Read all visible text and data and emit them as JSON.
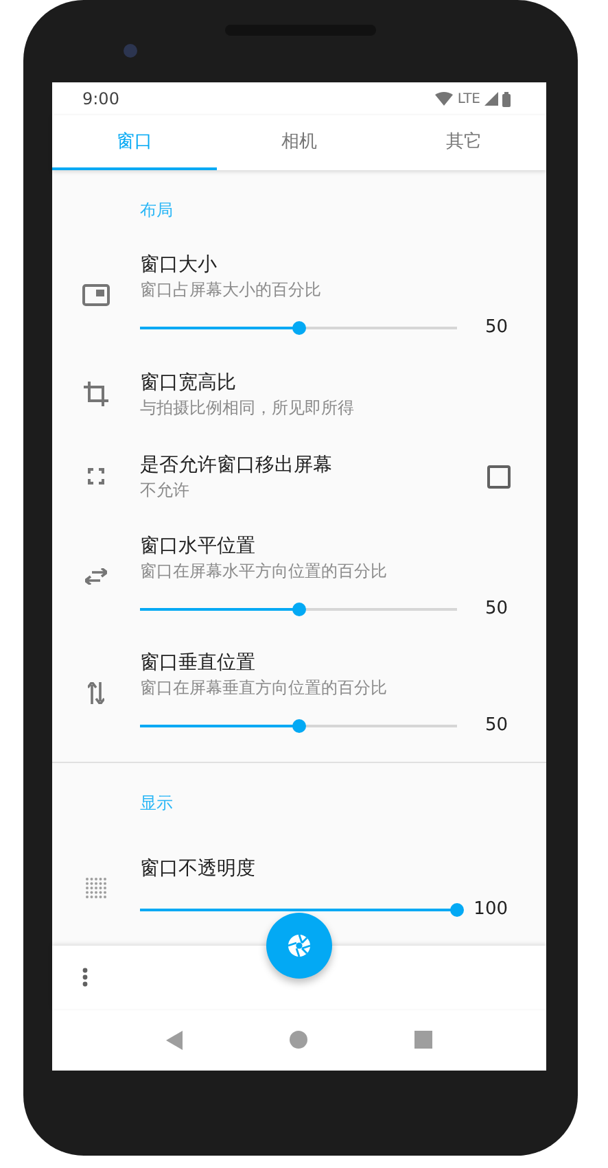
{
  "status_bar": {
    "time": "9:00",
    "network": "LTE"
  },
  "tabs": [
    {
      "label": "窗口",
      "selected": true
    },
    {
      "label": "相机",
      "selected": false
    },
    {
      "label": "其它",
      "selected": false
    }
  ],
  "sections": [
    {
      "title": "布局",
      "items": [
        {
          "kind": "slider",
          "title": "窗口大小",
          "subtitle": "窗口占屏幕大小的百分比",
          "level": 0.5,
          "reading": "50"
        },
        {
          "kind": "plain",
          "title": "窗口宽高比",
          "subtitle": "与拍摄比例相同，所见即所得"
        },
        {
          "kind": "checkbox",
          "title": "是否允许窗口移出屏幕",
          "subtitle": "不允许",
          "checked": false
        },
        {
          "kind": "slider",
          "title": "窗口水平位置",
          "subtitle": "窗口在屏幕水平方向位置的百分比",
          "level": 0.5,
          "reading": "50"
        },
        {
          "kind": "slider",
          "title": "窗口垂直位置",
          "subtitle": "窗口在屏幕垂直方向位置的百分比",
          "level": 0.5,
          "reading": "50"
        }
      ]
    },
    {
      "title": "显示",
      "items": [
        {
          "kind": "slider",
          "title": "窗口不透明度",
          "level": 1,
          "reading": "100"
        }
      ]
    }
  ]
}
